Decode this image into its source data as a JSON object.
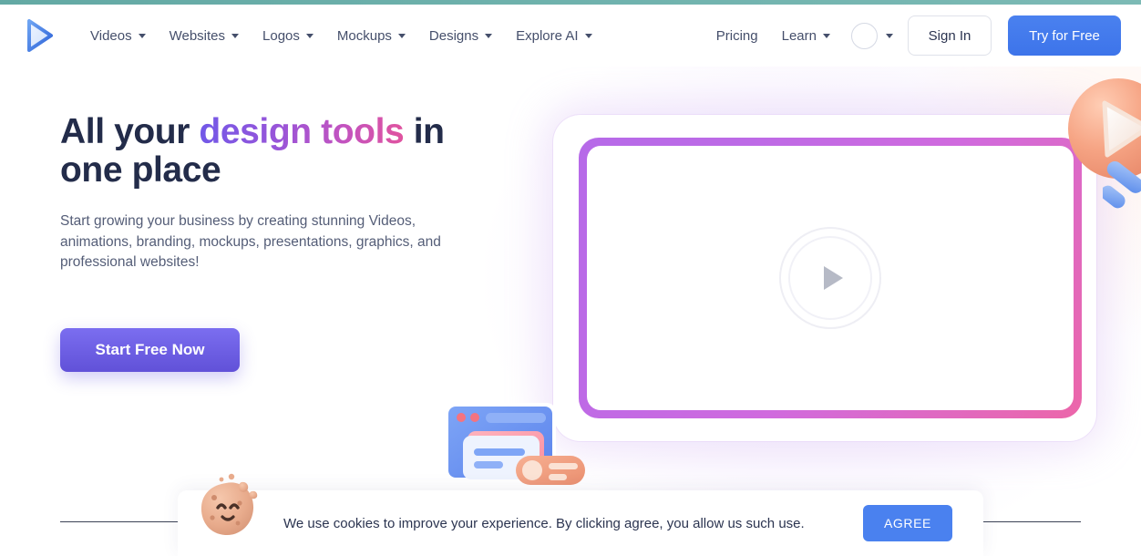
{
  "brand": {
    "logo_icon": "play-triangle-logo",
    "accent_blue": "#4a81ef",
    "accent_purple": "#6151d8",
    "accent_pink": "#ec66a9",
    "top_strip_color": "#6fb2ad"
  },
  "header": {
    "nav": [
      {
        "label": "Videos",
        "has_dropdown": true
      },
      {
        "label": "Websites",
        "has_dropdown": true
      },
      {
        "label": "Logos",
        "has_dropdown": true
      },
      {
        "label": "Mockups",
        "has_dropdown": true
      },
      {
        "label": "Designs",
        "has_dropdown": true
      },
      {
        "label": "Explore AI",
        "has_dropdown": true
      }
    ],
    "pricing_label": "Pricing",
    "learn_label": "Learn",
    "signin_label": "Sign In",
    "try_label": "Try for Free"
  },
  "hero": {
    "title_part1": "All your ",
    "title_highlight": "design tools",
    "title_part2": " in one place",
    "subtitle": "Start growing your business by creating stunning Videos, animations, branding, mockups, presentations, graphics, and professional websites!",
    "cta_label": "Start Free Now"
  },
  "video": {
    "play_icon": "play-icon",
    "border_gradient_start": "#b66ae8",
    "border_gradient_end": "#ec66a9"
  },
  "decorations": [
    {
      "name": "orange-play-sphere"
    },
    {
      "name": "blue-cursor-arrow"
    },
    {
      "name": "browser-window-illustration"
    }
  ],
  "cookie": {
    "icon": "cookie-icon",
    "message": "We use cookies to improve your experience. By clicking agree, you allow us such use.",
    "agree_label": "AGREE"
  }
}
